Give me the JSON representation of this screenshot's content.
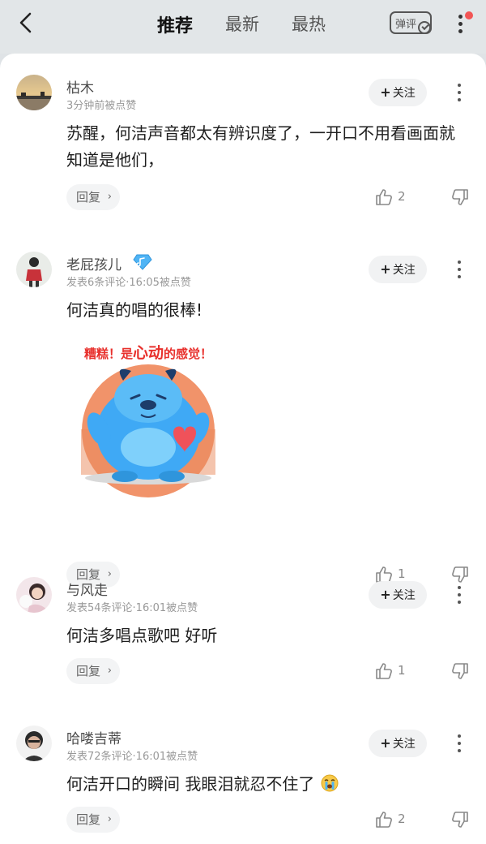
{
  "nav": {
    "tabs": [
      "推荐",
      "最新",
      "最热"
    ],
    "danmu_label": "弹评"
  },
  "comments": [
    {
      "user": "枯木",
      "meta": "3分钟前被点赞",
      "text": "苏醒，何洁声音都太有辨识度了，一开口不用看画面就知道是他们，",
      "likes": "2",
      "has_badge": false
    },
    {
      "user": "老屁孩儿",
      "meta": "发表6条评论·16:05被点赞",
      "text": "何洁真的唱的很棒!",
      "likes": "1",
      "has_badge": true,
      "sticker": {
        "caption": "糟糕！是心动的感觉！",
        "caption_parts": [
          "糟糕！是",
          "心动",
          "的感觉！"
        ]
      }
    },
    {
      "user": "与风走",
      "meta": "发表54条评论·16:01被点赞",
      "text": "何洁多唱点歌吧 好听",
      "likes": "1",
      "has_badge": false
    },
    {
      "user": "哈喽吉蒂",
      "meta": "发表72条评论·16:01被点赞",
      "text": "何洁开口的瞬间 我眼泪就忍不住了",
      "emoji": "crying-emoji",
      "likes": "2",
      "has_badge": false
    }
  ],
  "labels": {
    "follow": "关注",
    "follow_plus": "+",
    "reply": "回复",
    "reply_chevron": "›"
  },
  "colors": {
    "accent_red": "#f25555",
    "badge_blue": "#4fb4f5",
    "sticker_blue": "#3fa9f5"
  }
}
